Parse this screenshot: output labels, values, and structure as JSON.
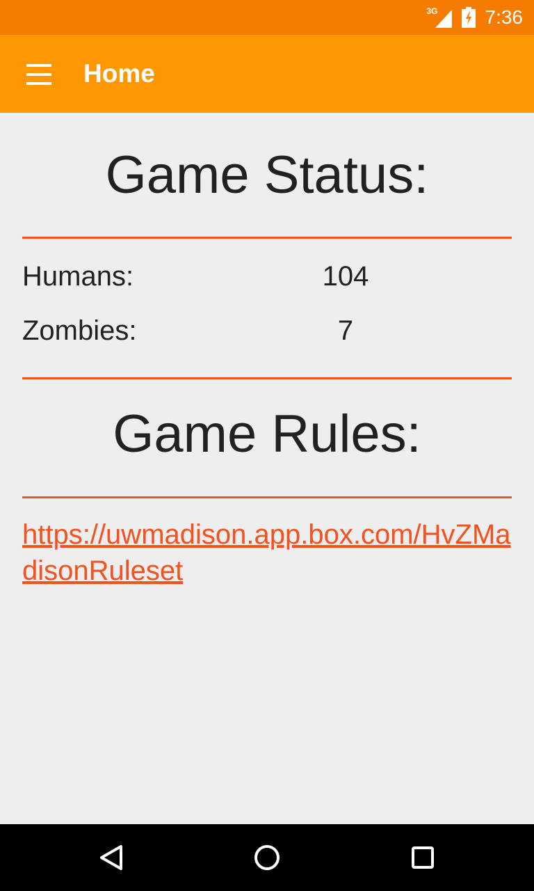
{
  "status_bar": {
    "network_type": "3G",
    "time": "7:36"
  },
  "app_bar": {
    "title": "Home",
    "menu_icon": "hamburger-menu-icon"
  },
  "game_status": {
    "title": "Game Status:",
    "humans_label": "Humans:",
    "humans_count": "104",
    "zombies_label": "Zombies:",
    "zombies_count": "7"
  },
  "game_rules": {
    "title": "Game Rules:",
    "link": "https://uwmadison.app.box.com/HvZMadisonRuleset"
  },
  "nav_bar": {
    "back_icon": "back-triangle-icon",
    "home_icon": "home-circle-icon",
    "recents_icon": "recents-square-icon"
  },
  "colors": {
    "status_bar": "#F57C00",
    "app_bar": "#FF9800",
    "accent": "#F4511E",
    "background": "#EEEEEE"
  }
}
